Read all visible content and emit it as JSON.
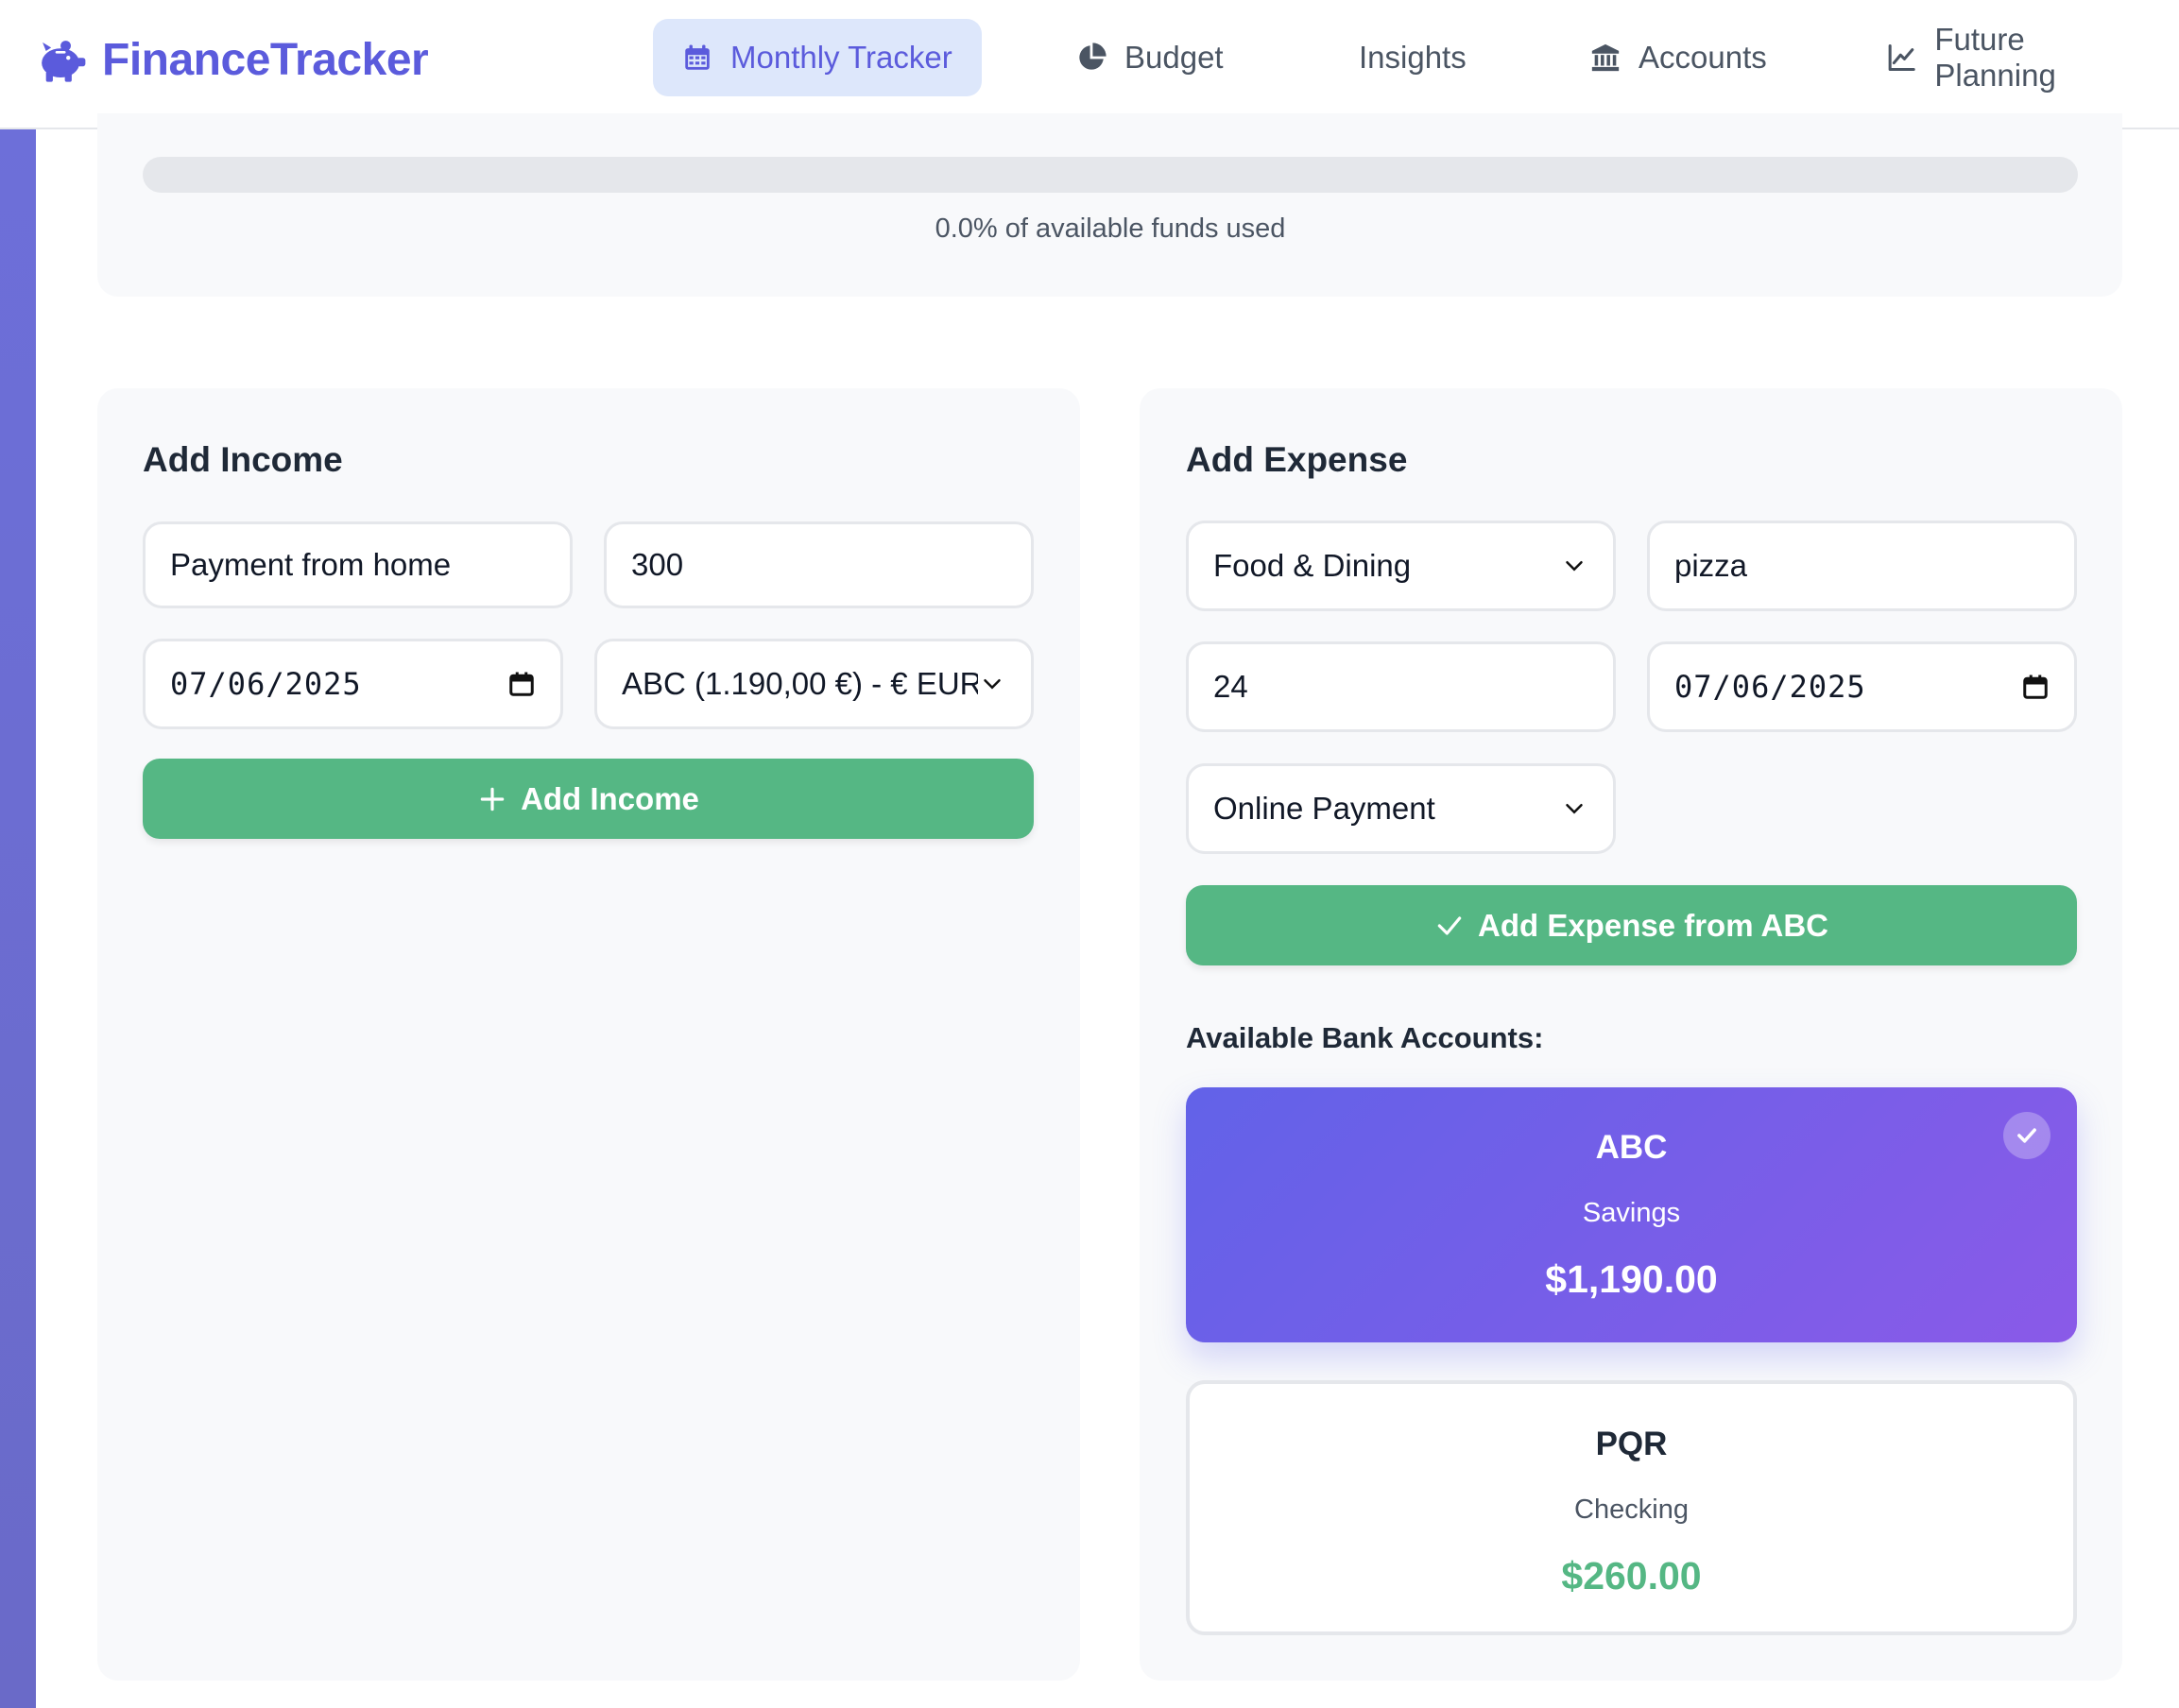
{
  "app": {
    "name": "FinanceTracker"
  },
  "nav": [
    {
      "label": "Monthly Tracker",
      "icon": "calendar-icon",
      "active": true
    },
    {
      "label": "Budget",
      "icon": "pie-chart-icon"
    },
    {
      "label": "Insights",
      "icon": ""
    },
    {
      "label": "Accounts",
      "icon": "bank-icon"
    },
    {
      "label": "Future Planning",
      "icon": "line-chart-icon"
    }
  ],
  "funds": {
    "used_fraction": 0.0,
    "text": "0.0% of available funds used"
  },
  "income": {
    "title": "Add Income",
    "description": "Payment from home",
    "amount": "300",
    "date": "07/06/2025",
    "account": "ABC (1.190,00 €) - € EUR",
    "button": "Add Income"
  },
  "expense": {
    "title": "Add Expense",
    "category": "Food & Dining",
    "description": "pizza",
    "amount": "24",
    "date": "07/06/2025",
    "payment_method": "Online Payment",
    "button": "Add Expense from ABC"
  },
  "accounts": {
    "label": "Available Bank Accounts:",
    "items": [
      {
        "name": "ABC",
        "type": "Savings",
        "balance": "$1,190.00",
        "selected": true
      },
      {
        "name": "PQR",
        "type": "Checking",
        "balance": "$260.00",
        "selected": false
      }
    ]
  },
  "colors": {
    "brand": "#5b5bdc",
    "green": "#55b784",
    "active_nav_bg": "#dde7fb"
  }
}
